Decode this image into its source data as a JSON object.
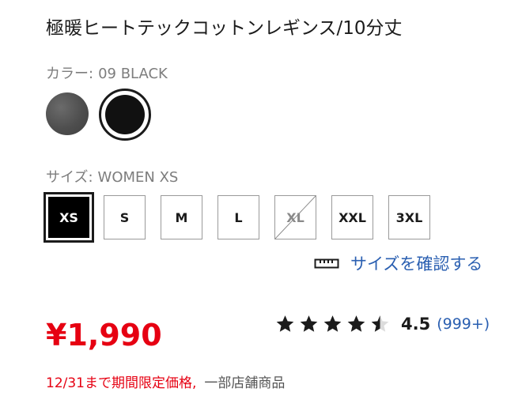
{
  "product": {
    "title": "極暖ヒートテックコットンレギンス/10分丈"
  },
  "color": {
    "label": "カラー:",
    "selected": "09 BLACK",
    "swatches": [
      {
        "name": "gray",
        "hex": "#555555"
      },
      {
        "name": "black",
        "hex": "#111111",
        "selected": true
      }
    ]
  },
  "size": {
    "label": "サイズ:",
    "selected": "WOMEN XS",
    "options": [
      {
        "label": "XS",
        "selected": true,
        "available": true
      },
      {
        "label": "S",
        "available": true
      },
      {
        "label": "M",
        "available": true
      },
      {
        "label": "L",
        "available": true
      },
      {
        "label": "XL",
        "available": false
      },
      {
        "label": "XXL",
        "available": true
      },
      {
        "label": "3XL",
        "available": true
      }
    ],
    "guide_link": "サイズを確認する",
    "guide_icon": "ruler-icon"
  },
  "price": {
    "amount": "¥1,990",
    "promo_text": "12/31まで期間限定価格,",
    "store_text": "一部店舗商品"
  },
  "rating": {
    "value": "4.5",
    "count": "(999+)",
    "stars": 4.5,
    "max": 5
  },
  "colors": {
    "price_red": "#e60012",
    "link_blue": "#2a5fb1"
  }
}
